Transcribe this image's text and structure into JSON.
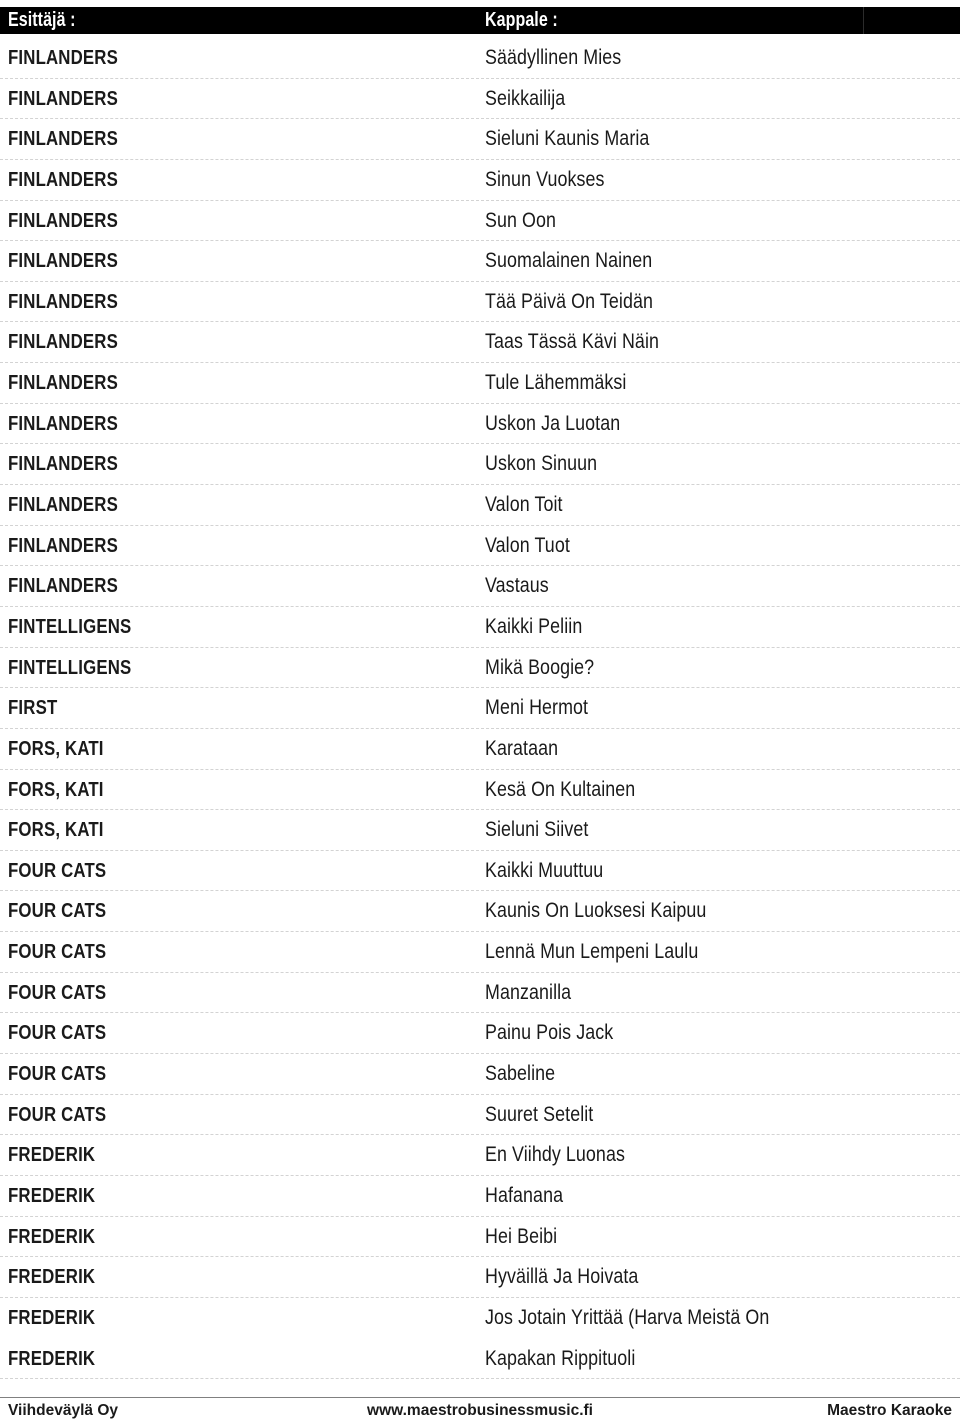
{
  "header": {
    "artist_column": "Esittäjä :",
    "song_column": "Kappale :"
  },
  "footer": {
    "left": "Viihdeväylä Oy",
    "center": "www.maestrobusinessmusic.fi",
    "right": "Maestro Karaoke"
  },
  "colors": {
    "header_background": "#000000",
    "header_text": "#ffffff",
    "body_text": "#1a1a1a",
    "row_separator": "#d3d3d3",
    "footer_rule": "#808080",
    "page_background": "#ffffff"
  },
  "table": {
    "columns": [
      "Esittäjä :",
      "Kappale :"
    ],
    "row_count": 34,
    "rows": [
      {
        "artist": "FINLANDERS",
        "song": "Säädyllinen Mies"
      },
      {
        "artist": "FINLANDERS",
        "song": "Seikkailija"
      },
      {
        "artist": "FINLANDERS",
        "song": "Sieluni Kaunis Maria"
      },
      {
        "artist": "FINLANDERS",
        "song": "Sinun Vuokses"
      },
      {
        "artist": "FINLANDERS",
        "song": "Sun Oon"
      },
      {
        "artist": "FINLANDERS",
        "song": "Suomalainen Nainen"
      },
      {
        "artist": "FINLANDERS",
        "song": "Tää Päivä On Teidän"
      },
      {
        "artist": "FINLANDERS",
        "song": "Taas Tässä Kävi Näin"
      },
      {
        "artist": "FINLANDERS",
        "song": "Tule Lähemmäksi"
      },
      {
        "artist": "FINLANDERS",
        "song": "Uskon Ja Luotan"
      },
      {
        "artist": "FINLANDERS",
        "song": "Uskon Sinuun"
      },
      {
        "artist": "FINLANDERS",
        "song": "Valon Toit"
      },
      {
        "artist": "FINLANDERS",
        "song": "Valon Tuot"
      },
      {
        "artist": "FINLANDERS",
        "song": "Vastaus"
      },
      {
        "artist": "FINTELLIGENS",
        "song": "Kaikki Peliin"
      },
      {
        "artist": "FINTELLIGENS",
        "song": "Mikä Boogie?"
      },
      {
        "artist": "FIRST",
        "song": "Meni Hermot"
      },
      {
        "artist": "FORS, KATI",
        "song": "Karataan"
      },
      {
        "artist": "FORS, KATI",
        "song": "Kesä On Kultainen"
      },
      {
        "artist": "FORS, KATI",
        "song": "Sieluni Siivet"
      },
      {
        "artist": "FOUR CATS",
        "song": "Kaikki Muuttuu"
      },
      {
        "artist": "FOUR CATS",
        "song": "Kaunis On Luoksesi Kaipuu"
      },
      {
        "artist": "FOUR CATS",
        "song": "Lennä Mun Lempeni Laulu"
      },
      {
        "artist": "FOUR CATS",
        "song": "Manzanilla"
      },
      {
        "artist": "FOUR CATS",
        "song": "Painu Pois Jack"
      },
      {
        "artist": "FOUR CATS",
        "song": "Sabeline"
      },
      {
        "artist": "FOUR CATS",
        "song": "Suuret Setelit"
      },
      {
        "artist": "FREDERIK",
        "song": "En Viihdy Luonas"
      },
      {
        "artist": "FREDERIK",
        "song": "Hafanana"
      },
      {
        "artist": "FREDERIK",
        "song": "Hei Beibi"
      },
      {
        "artist": "FREDERIK",
        "song": "Hyväillä Ja Hoivata"
      },
      {
        "artist": "FREDERIK",
        "song": "Jos Jotain Yrittää (Harva Meistä On",
        "separator": false
      },
      {
        "artist": "FREDERIK",
        "song": "Kapakan Rippituoli"
      }
    ]
  }
}
